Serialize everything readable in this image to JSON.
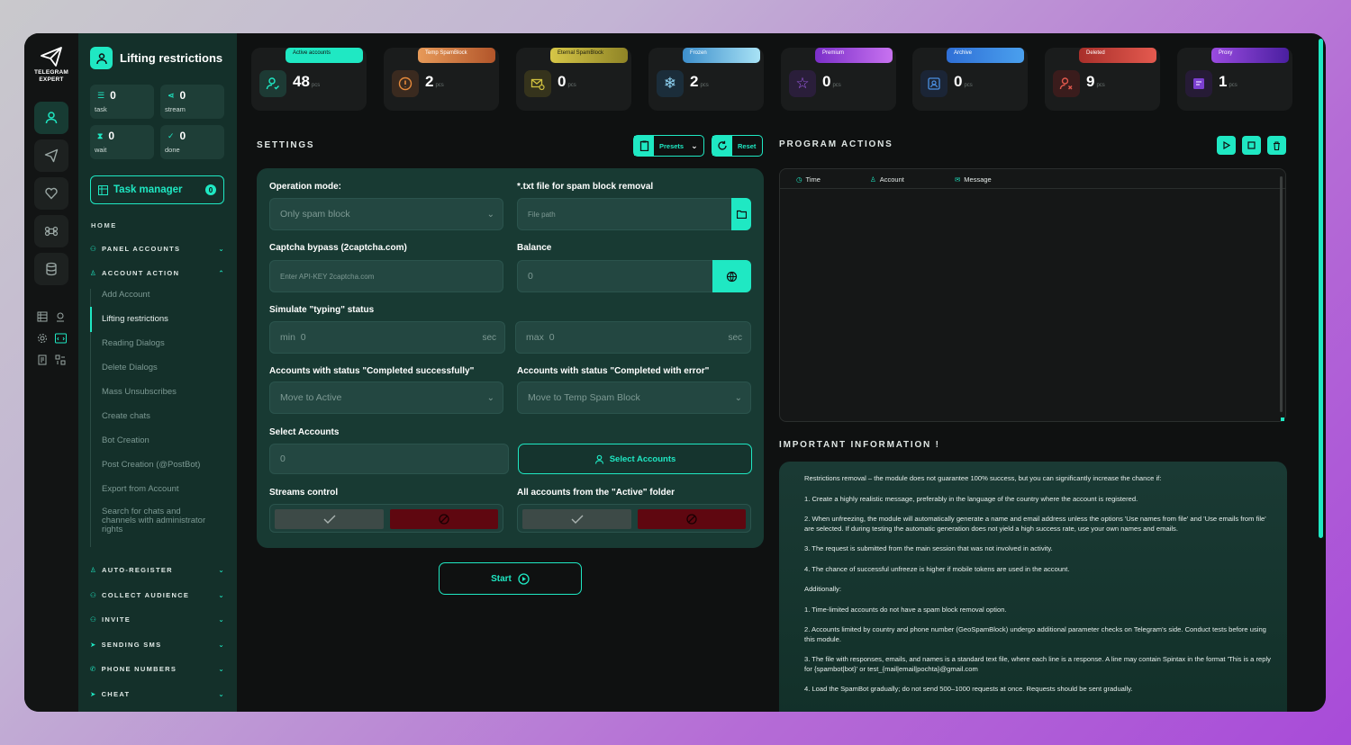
{
  "colors": {
    "accent": "#1fe8c3",
    "danger": "#5f0710",
    "panel": "#183a33"
  },
  "logo": {
    "text": "TELEGRAM EXPERT"
  },
  "sidebar": {
    "title": "Lifting restrictions",
    "stats": [
      {
        "value": "0",
        "label": "task"
      },
      {
        "value": "0",
        "label": "stream"
      },
      {
        "value": "0",
        "label": "wait"
      },
      {
        "value": "0",
        "label": "done"
      }
    ],
    "task_manager": {
      "label": "Task manager",
      "count": "0"
    },
    "home": "HOME",
    "panel_accounts": "PANEL ACCOUNTS",
    "account_action": "ACCOUNT ACTION",
    "subnav": [
      "Add Account",
      "Lifting restrictions",
      "Reading Dialogs",
      "Delete Dialogs",
      "Mass Unsubscribes",
      "Create chats",
      "Bot Creation",
      "Post Creation (@PostBot)",
      "Export from Account",
      "Search for chats and channels with administrator rights"
    ],
    "sections": [
      "AUTO-REGISTER",
      "COLLECT AUDIENCE",
      "INVITE",
      "SENDING SMS",
      "PHONE NUMBERS",
      "CHEAT"
    ]
  },
  "cards": [
    {
      "tag": "Active accounts",
      "value": "48",
      "unit": "pcs",
      "color": "#1fe8c3"
    },
    {
      "tag": "Temp SpamBlock",
      "value": "2",
      "unit": "pcs",
      "color": "#c96a2c"
    },
    {
      "tag": "Eternal SpamBlock",
      "value": "0",
      "unit": "pcs",
      "color": "#b0a430"
    },
    {
      "tag": "Frozen",
      "value": "2",
      "unit": "pcs",
      "color": "#5fbbe6"
    },
    {
      "tag": "Premium",
      "value": "0",
      "unit": "pcs",
      "color": "#a24ce0"
    },
    {
      "tag": "Archive",
      "value": "0",
      "unit": "pcs",
      "color": "#2e6fd8"
    },
    {
      "tag": "Deleted",
      "value": "9",
      "unit": "pcs",
      "color": "#d4453e"
    },
    {
      "tag": "Proxy",
      "value": "1",
      "unit": "pcs",
      "color": "#6d33c4"
    }
  ],
  "settings": {
    "title": "SETTINGS",
    "presets": "Presets",
    "reset": "Reset",
    "operation_mode_label": "Operation mode:",
    "operation_mode_value": "Only spam block",
    "txt_label": "*.txt file for spam block removal",
    "txt_placeholder": "File path",
    "captcha_label": "Captcha bypass (2captcha.com)",
    "captcha_placeholder": "Enter API-KEY 2captcha.com",
    "balance_label": "Balance",
    "balance_value": "0",
    "typing_label": "Simulate \"typing\" status",
    "min_label": "min",
    "min_value": "0",
    "max_label": "max",
    "max_value": "0",
    "sec": "sec",
    "success_label": "Accounts with status \"Completed successfully\"",
    "success_value": "Move to Active",
    "error_label": "Accounts with status \"Completed with error\"",
    "error_value": "Move to Temp Spam Block",
    "select_label": "Select Accounts",
    "select_value": "0",
    "select_button": "Select Accounts",
    "streams_label": "Streams control",
    "all_accounts_label": "All accounts from the \"Active\" folder",
    "start": "Start"
  },
  "program_actions": {
    "title": "PROGRAM ACTIONS",
    "columns": [
      "Time",
      "Account",
      "Message"
    ]
  },
  "important": {
    "title": "IMPORTANT INFORMATION !",
    "paragraphs": [
      "Restrictions removal – the module does not guarantee 100% success, but you can significantly increase the chance if:",
      "1. Create a highly realistic message, preferably in the language of the country where the account is registered.",
      "2. When unfreezing, the module will automatically generate a name and email address unless the options 'Use names from file' and 'Use emails from file' are selected. If during testing the automatic generation does not yield a high success rate, use your own names and emails.",
      "3. The request is submitted from the main session that was not involved in activity.",
      "4. The chance of successful unfreeze is higher if mobile tokens are used in the account.",
      "Additionally:",
      "1. Time-limited accounts do not have a spam block removal option.",
      "2. Accounts limited by country and phone number (GeoSpamBlock) undergo additional parameter checks on Telegram's side. Conduct tests before using this module.",
      "3. The file with responses, emails, and names is a standard text file, where each line is a response. A line may contain Spintax in the format 'This is a reply for {spambot|bot}' or test_{mail|email|pochta}@gmail.com",
      "4. Load the SpamBot gradually; do not send 500–1000 requests at once. Requests should be sent gradually."
    ]
  }
}
